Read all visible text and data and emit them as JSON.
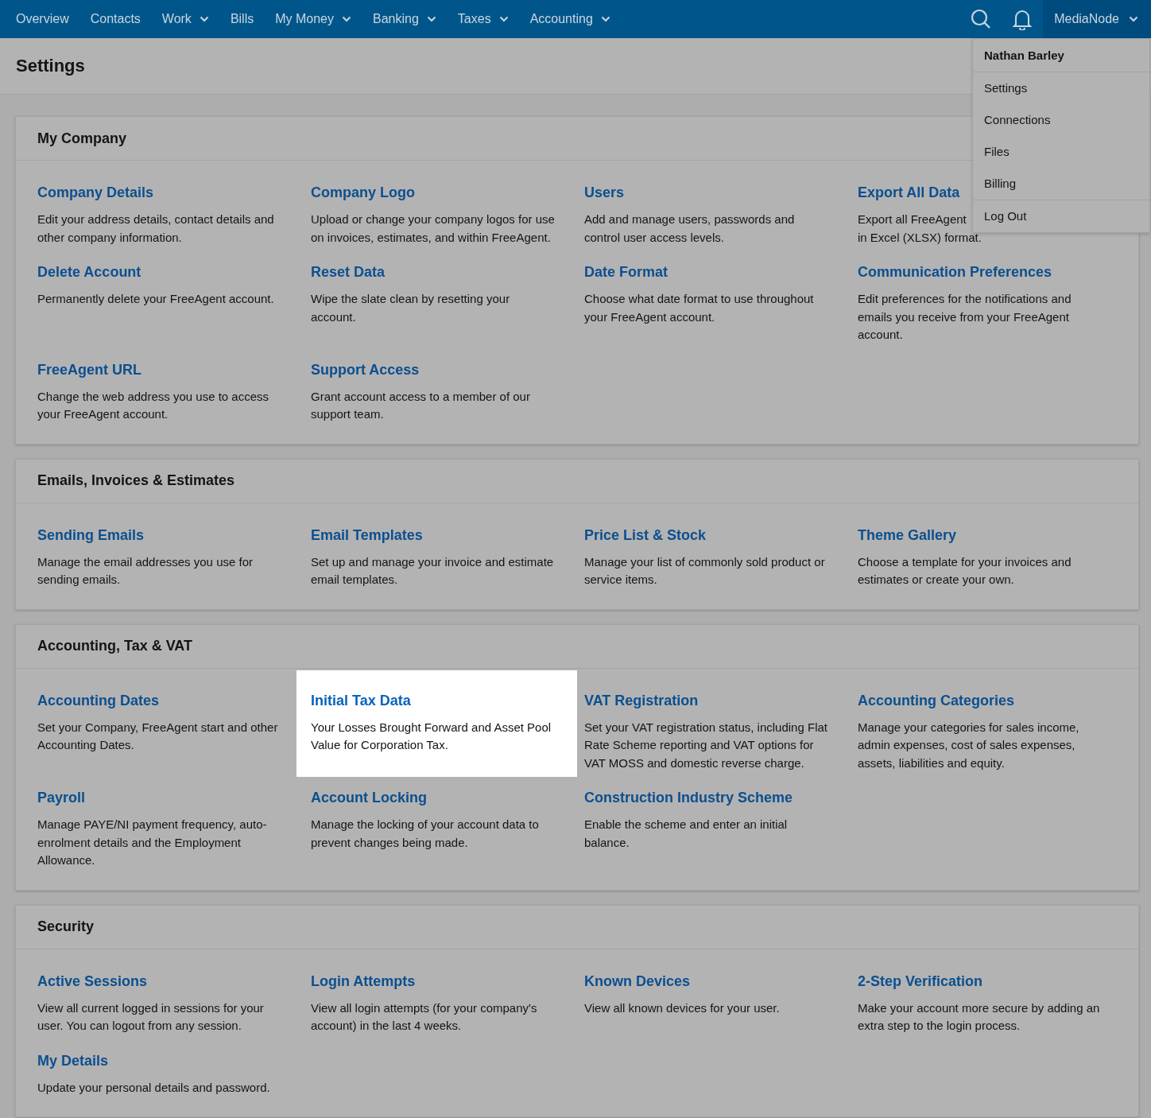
{
  "nav": {
    "items": [
      {
        "label": "Overview",
        "has_menu": false
      },
      {
        "label": "Contacts",
        "has_menu": false
      },
      {
        "label": "Work",
        "has_menu": true
      },
      {
        "label": "Bills",
        "has_menu": false
      },
      {
        "label": "My Money",
        "has_menu": true
      },
      {
        "label": "Banking",
        "has_menu": true
      },
      {
        "label": "Taxes",
        "has_menu": true
      },
      {
        "label": "Accounting",
        "has_menu": true
      }
    ],
    "account": {
      "label": "MediaNode",
      "expanded": true
    }
  },
  "account_menu": {
    "user": "Nathan Barley",
    "groups": [
      [
        "Settings",
        "Connections",
        "Files",
        "Billing"
      ],
      [
        "Log Out"
      ]
    ]
  },
  "page_title": "Settings",
  "sections": [
    {
      "title": "My Company",
      "items": [
        {
          "title": "Company Details",
          "description": "Edit your address details, contact details and other company information.",
          "highlighted": false
        },
        {
          "title": "Company Logo",
          "description": "Upload or change your company logos for use on invoices, estimates, and within FreeAgent.",
          "highlighted": false
        },
        {
          "title": "Users",
          "description": "Add and manage users, passwords and control user access levels.",
          "highlighted": false
        },
        {
          "title": "Export All Data",
          "description": "Export all FreeAgent\nin Excel (XLSX) format.",
          "highlighted": false
        },
        {
          "title": "Delete Account",
          "description": "Permanently delete your FreeAgent account.",
          "highlighted": false
        },
        {
          "title": "Reset Data",
          "description": "Wipe the slate clean by resetting your account.",
          "highlighted": false
        },
        {
          "title": "Date Format",
          "description": "Choose what date format to use throughout your FreeAgent account.",
          "highlighted": false
        },
        {
          "title": "Communication Preferences",
          "description": "Edit preferences for the notifications and emails you receive from your FreeAgent account.",
          "highlighted": false
        },
        {
          "title": "FreeAgent URL",
          "description": "Change the web address you use to access your FreeAgent account.",
          "highlighted": false
        },
        {
          "title": "Support Access",
          "description": "Grant account access to a member of our support team.",
          "highlighted": false
        }
      ]
    },
    {
      "title": "Emails, Invoices & Estimates",
      "items": [
        {
          "title": "Sending Emails",
          "description": "Manage the email addresses you use for sending emails.",
          "highlighted": false
        },
        {
          "title": "Email Templates",
          "description": "Set up and manage your invoice and estimate email templates.",
          "highlighted": false
        },
        {
          "title": "Price List & Stock",
          "description": "Manage your list of commonly sold product or service items.",
          "highlighted": false
        },
        {
          "title": "Theme Gallery",
          "description": "Choose a template for your invoices and estimates or create your own.",
          "highlighted": false
        }
      ]
    },
    {
      "title": "Accounting, Tax & VAT",
      "items": [
        {
          "title": "Accounting Dates",
          "description": "Set your Company, FreeAgent start and other Accounting Dates.",
          "highlighted": false
        },
        {
          "title": "Initial Tax Data",
          "description": "Your Losses Brought Forward and Asset Pool Value for Corporation Tax.",
          "highlighted": true
        },
        {
          "title": "VAT Registration",
          "description": "Set your VAT registration status, including Flat Rate Scheme reporting and VAT options for VAT MOSS and domestic reverse charge.",
          "highlighted": false
        },
        {
          "title": "Accounting Categories",
          "description": "Manage your categories for sales income, admin expenses, cost of sales expenses, assets, liabilities and equity.",
          "highlighted": false
        },
        {
          "title": "Payroll",
          "description": "Manage PAYE/NI payment frequency, auto-enrolment details and the Employment Allowance.",
          "highlighted": false
        },
        {
          "title": "Account Locking",
          "description": "Manage the locking of your account data to prevent changes being made.",
          "highlighted": false
        },
        {
          "title": "Construction Industry Scheme",
          "description": "Enable the scheme and enter an initial balance.",
          "highlighted": false
        }
      ]
    },
    {
      "title": "Security",
      "items": [
        {
          "title": "Active Sessions",
          "description": "View all current logged in sessions for your user. You can logout from any session.",
          "highlighted": false
        },
        {
          "title": "Login Attempts",
          "description": "View all login attempts (for your company's account) in the last 4 weeks.",
          "highlighted": false
        },
        {
          "title": "Known Devices",
          "description": "View all known devices for your user.",
          "highlighted": false
        },
        {
          "title": "2-Step Verification",
          "description": "Make your account more secure by adding an extra step to the login process.",
          "highlighted": false
        },
        {
          "title": "My Details",
          "description": "Update your personal details and password.",
          "highlighted": false
        }
      ]
    }
  ]
}
